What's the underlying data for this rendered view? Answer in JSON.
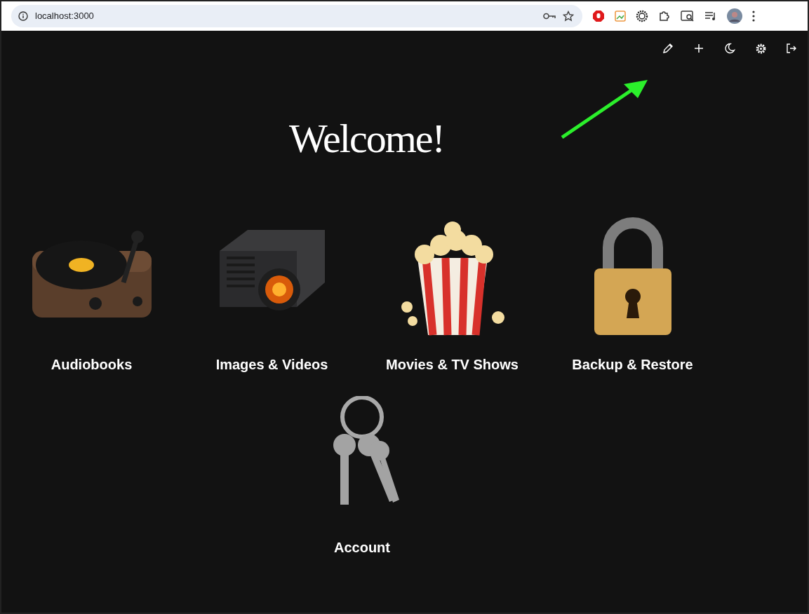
{
  "browser": {
    "url": "localhost:3000"
  },
  "heading": "Welcome!",
  "tiles": [
    {
      "kind": "turntable",
      "label": "Audiobooks"
    },
    {
      "kind": "projector",
      "label": "Images & Videos"
    },
    {
      "kind": "popcorn",
      "label": "Movies & TV Shows"
    },
    {
      "kind": "padlock",
      "label": "Backup & Restore"
    },
    {
      "kind": "keys",
      "label": "Account"
    }
  ]
}
